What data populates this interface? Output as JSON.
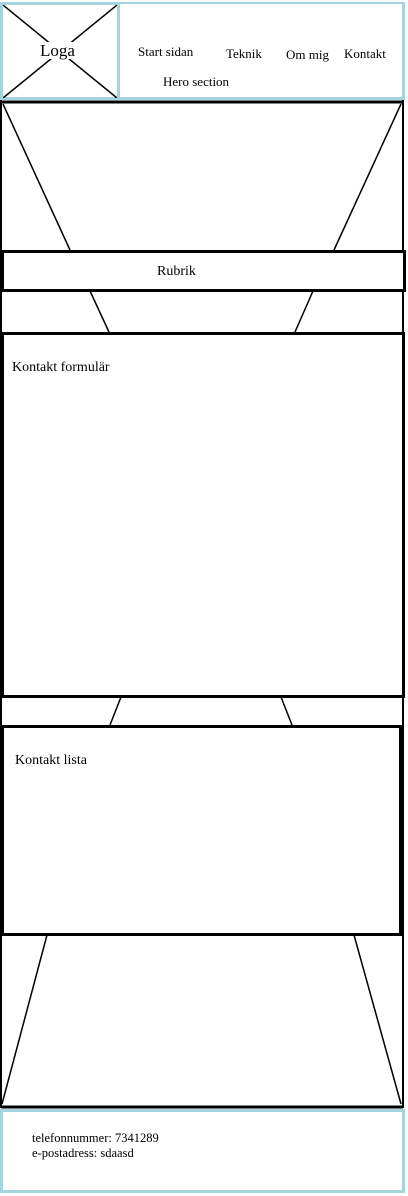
{
  "header": {
    "logo_label": "Loga",
    "nav": [
      {
        "label": "Start sidan"
      },
      {
        "label": "Teknik"
      },
      {
        "label": "Om mig"
      },
      {
        "label": "Kontakt"
      }
    ],
    "hero_link": "Hero section"
  },
  "sections": {
    "heading_label": "Rubrik",
    "form_label": "Kontakt formulär",
    "list_label": "Kontakt lista"
  },
  "footer": {
    "phone_text": "telefonnummer: 7341289",
    "email_text": "e-postadress: sdaasd"
  },
  "colors": {
    "header_border": "#a4d4e0",
    "footer_border": "#a4d4e0",
    "ink": "#000000"
  }
}
